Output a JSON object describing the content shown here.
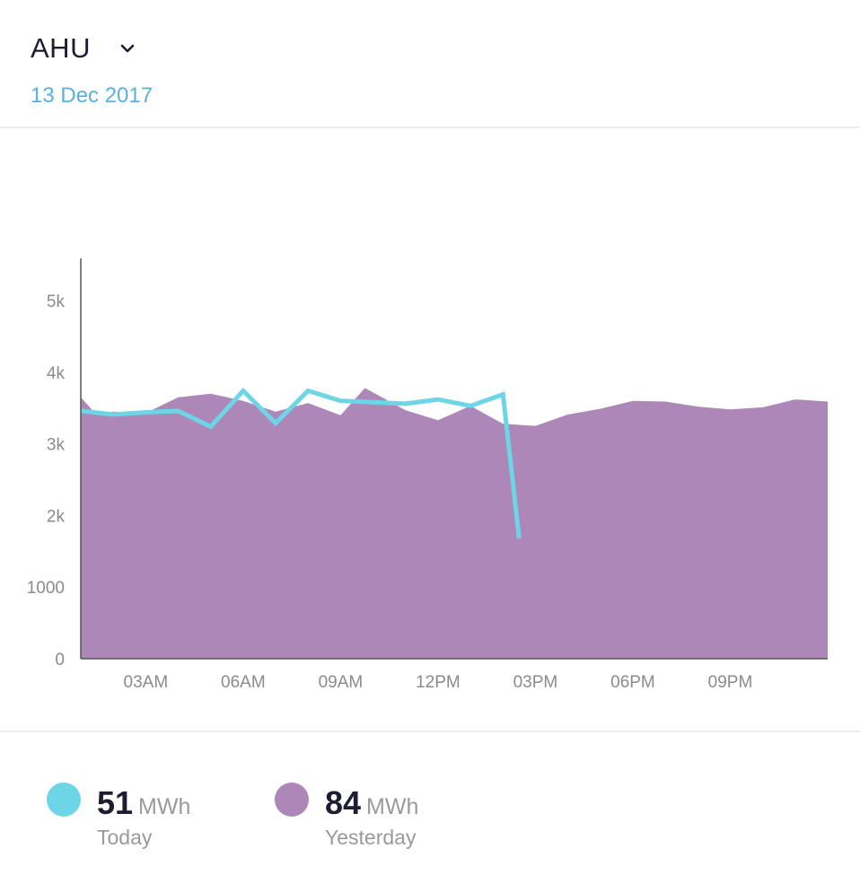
{
  "header": {
    "title": "AHU",
    "date": "13 Dec 2017",
    "dropdown_icon": "chevron-down-icon"
  },
  "colors": {
    "today": "#6dd5e6",
    "yesterday": "#ad87b8",
    "date_text": "#5bb0de",
    "title_text": "#1c1d33"
  },
  "chart_data": {
    "type": "area",
    "x_unit": "hour of day",
    "xlim": [
      0,
      23
    ],
    "ylim": [
      0,
      5600
    ],
    "y_ticks": [
      {
        "value": 0,
        "label": "0"
      },
      {
        "value": 1000,
        "label": "1000"
      },
      {
        "value": 2000,
        "label": "2k"
      },
      {
        "value": 3000,
        "label": "3k"
      },
      {
        "value": 4000,
        "label": "4k"
      },
      {
        "value": 5000,
        "label": "5k"
      }
    ],
    "x_ticks": [
      {
        "value": 2,
        "label": "03AM"
      },
      {
        "value": 5,
        "label": "06AM"
      },
      {
        "value": 8,
        "label": "09AM"
      },
      {
        "value": 11,
        "label": "12PM"
      },
      {
        "value": 14,
        "label": "03PM"
      },
      {
        "value": 17,
        "label": "06PM"
      },
      {
        "value": 20,
        "label": "09PM"
      }
    ],
    "grid": false,
    "series": [
      {
        "name": "Yesterday",
        "type": "area",
        "x": [
          0,
          0.5,
          1,
          2,
          3,
          4,
          5,
          6,
          7,
          8,
          8.75,
          10,
          11,
          12,
          13,
          14,
          15,
          16,
          17,
          18,
          19,
          20,
          21,
          22,
          23
        ],
        "values": [
          3650,
          3400,
          3450,
          3430,
          3650,
          3700,
          3600,
          3450,
          3570,
          3400,
          3780,
          3470,
          3330,
          3530,
          3280,
          3250,
          3410,
          3490,
          3600,
          3590,
          3520,
          3480,
          3510,
          3620,
          3590
        ]
      },
      {
        "name": "Today",
        "type": "line",
        "x": [
          0,
          1,
          2,
          3,
          4,
          5,
          6,
          7,
          8,
          9,
          10,
          11,
          12,
          13,
          13.5
        ],
        "values": [
          3460,
          3410,
          3440,
          3460,
          3240,
          3740,
          3290,
          3740,
          3600,
          3580,
          3560,
          3620,
          3530,
          3690,
          1680
        ]
      }
    ]
  },
  "legend": {
    "today": {
      "value": "51",
      "unit": "MWh",
      "label": "Today"
    },
    "yesterday": {
      "value": "84",
      "unit": "MWh",
      "label": "Yesterday"
    }
  }
}
